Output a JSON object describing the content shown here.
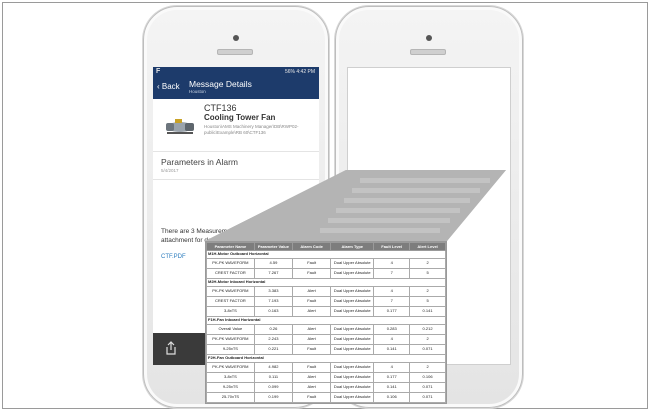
{
  "phone1": {
    "status": {
      "left": "F",
      "right": "56% 4:42 PM"
    },
    "header": {
      "back_label": "‹ Back",
      "title": "Message Details",
      "subtitle": "Houston"
    },
    "asset": {
      "id": "CTF136",
      "name": "Cooling Tower Fan",
      "path": "Houston\\AMS Machinery Manager\\DB\\RWP02-public\\Example\\RB 60\\CTF136"
    },
    "section": {
      "title": "Parameters in Alarm",
      "date": "5/4/2017"
    },
    "message": "There are 3 Measurement Locations in alarm. See attachment for details",
    "attachment": "CTF.PDF"
  },
  "report": {
    "columns": [
      "Parameter Name",
      "Parameter Value",
      "Alarm Code",
      "Alarm Type",
      "Fault Level",
      "Alert Level"
    ],
    "groups": [
      {
        "title": "M1H-Motor Outboard Horizontal",
        "rows": [
          [
            "PK-PK WAVEFORM",
            "4.59",
            "Fault",
            "Dual Upper Absolute",
            "4",
            "2"
          ],
          [
            "CREST FACTOR",
            "7.267",
            "Fault",
            "Dual Upper Absolute",
            "7",
            "5"
          ]
        ]
      },
      {
        "title": "M2H-Motor Inboard Horizontal",
        "rows": [
          [
            "PK-PK WAVEFORM",
            "3.383",
            "Alert",
            "Dual Upper Absolute",
            "4",
            "2"
          ],
          [
            "CREST FACTOR",
            "7.193",
            "Fault",
            "Dual Upper Absolute",
            "7",
            "5"
          ],
          [
            "3-8xTS",
            "0.163",
            "Alert",
            "Dual Upper Absolute",
            "0.177",
            "0.141"
          ]
        ]
      },
      {
        "title": "F1H-Fan Inboard Horizontal",
        "rows": [
          [
            "Overall Value",
            "0.26",
            "Alert",
            "Dual Upper Absolute",
            "0.283",
            "0.212"
          ],
          [
            "PK-PK WAVEFORM",
            "2.243",
            "Alert",
            "Dual Upper Absolute",
            "4",
            "2"
          ],
          [
            "9-25xTS",
            "0.221",
            "Fault",
            "Dual Upper Absolute",
            "0.141",
            "0.071"
          ]
        ]
      },
      {
        "title": "F2H-Fan Outboard Horizontal",
        "rows": [
          [
            "PK-PK WAVEFORM",
            "4.982",
            "Fault",
            "Dual Upper Absolute",
            "4",
            "2"
          ],
          [
            "3-8xTS",
            "0.111",
            "Alert",
            "Dual Upper Absolute",
            "0.177",
            "0.106"
          ],
          [
            "9-25xTS",
            "0.099",
            "Alert",
            "Dual Upper Absolute",
            "0.141",
            "0.071"
          ],
          [
            "25-70xTS",
            "0.199",
            "Fault",
            "Dual Upper Absolute",
            "0.106",
            "0.071"
          ]
        ]
      }
    ]
  },
  "colors": {
    "appbar": "#1d3b6b",
    "link": "#2a7bbd",
    "callout": "#a9a9a9",
    "table_header": "#7d7d7d"
  }
}
